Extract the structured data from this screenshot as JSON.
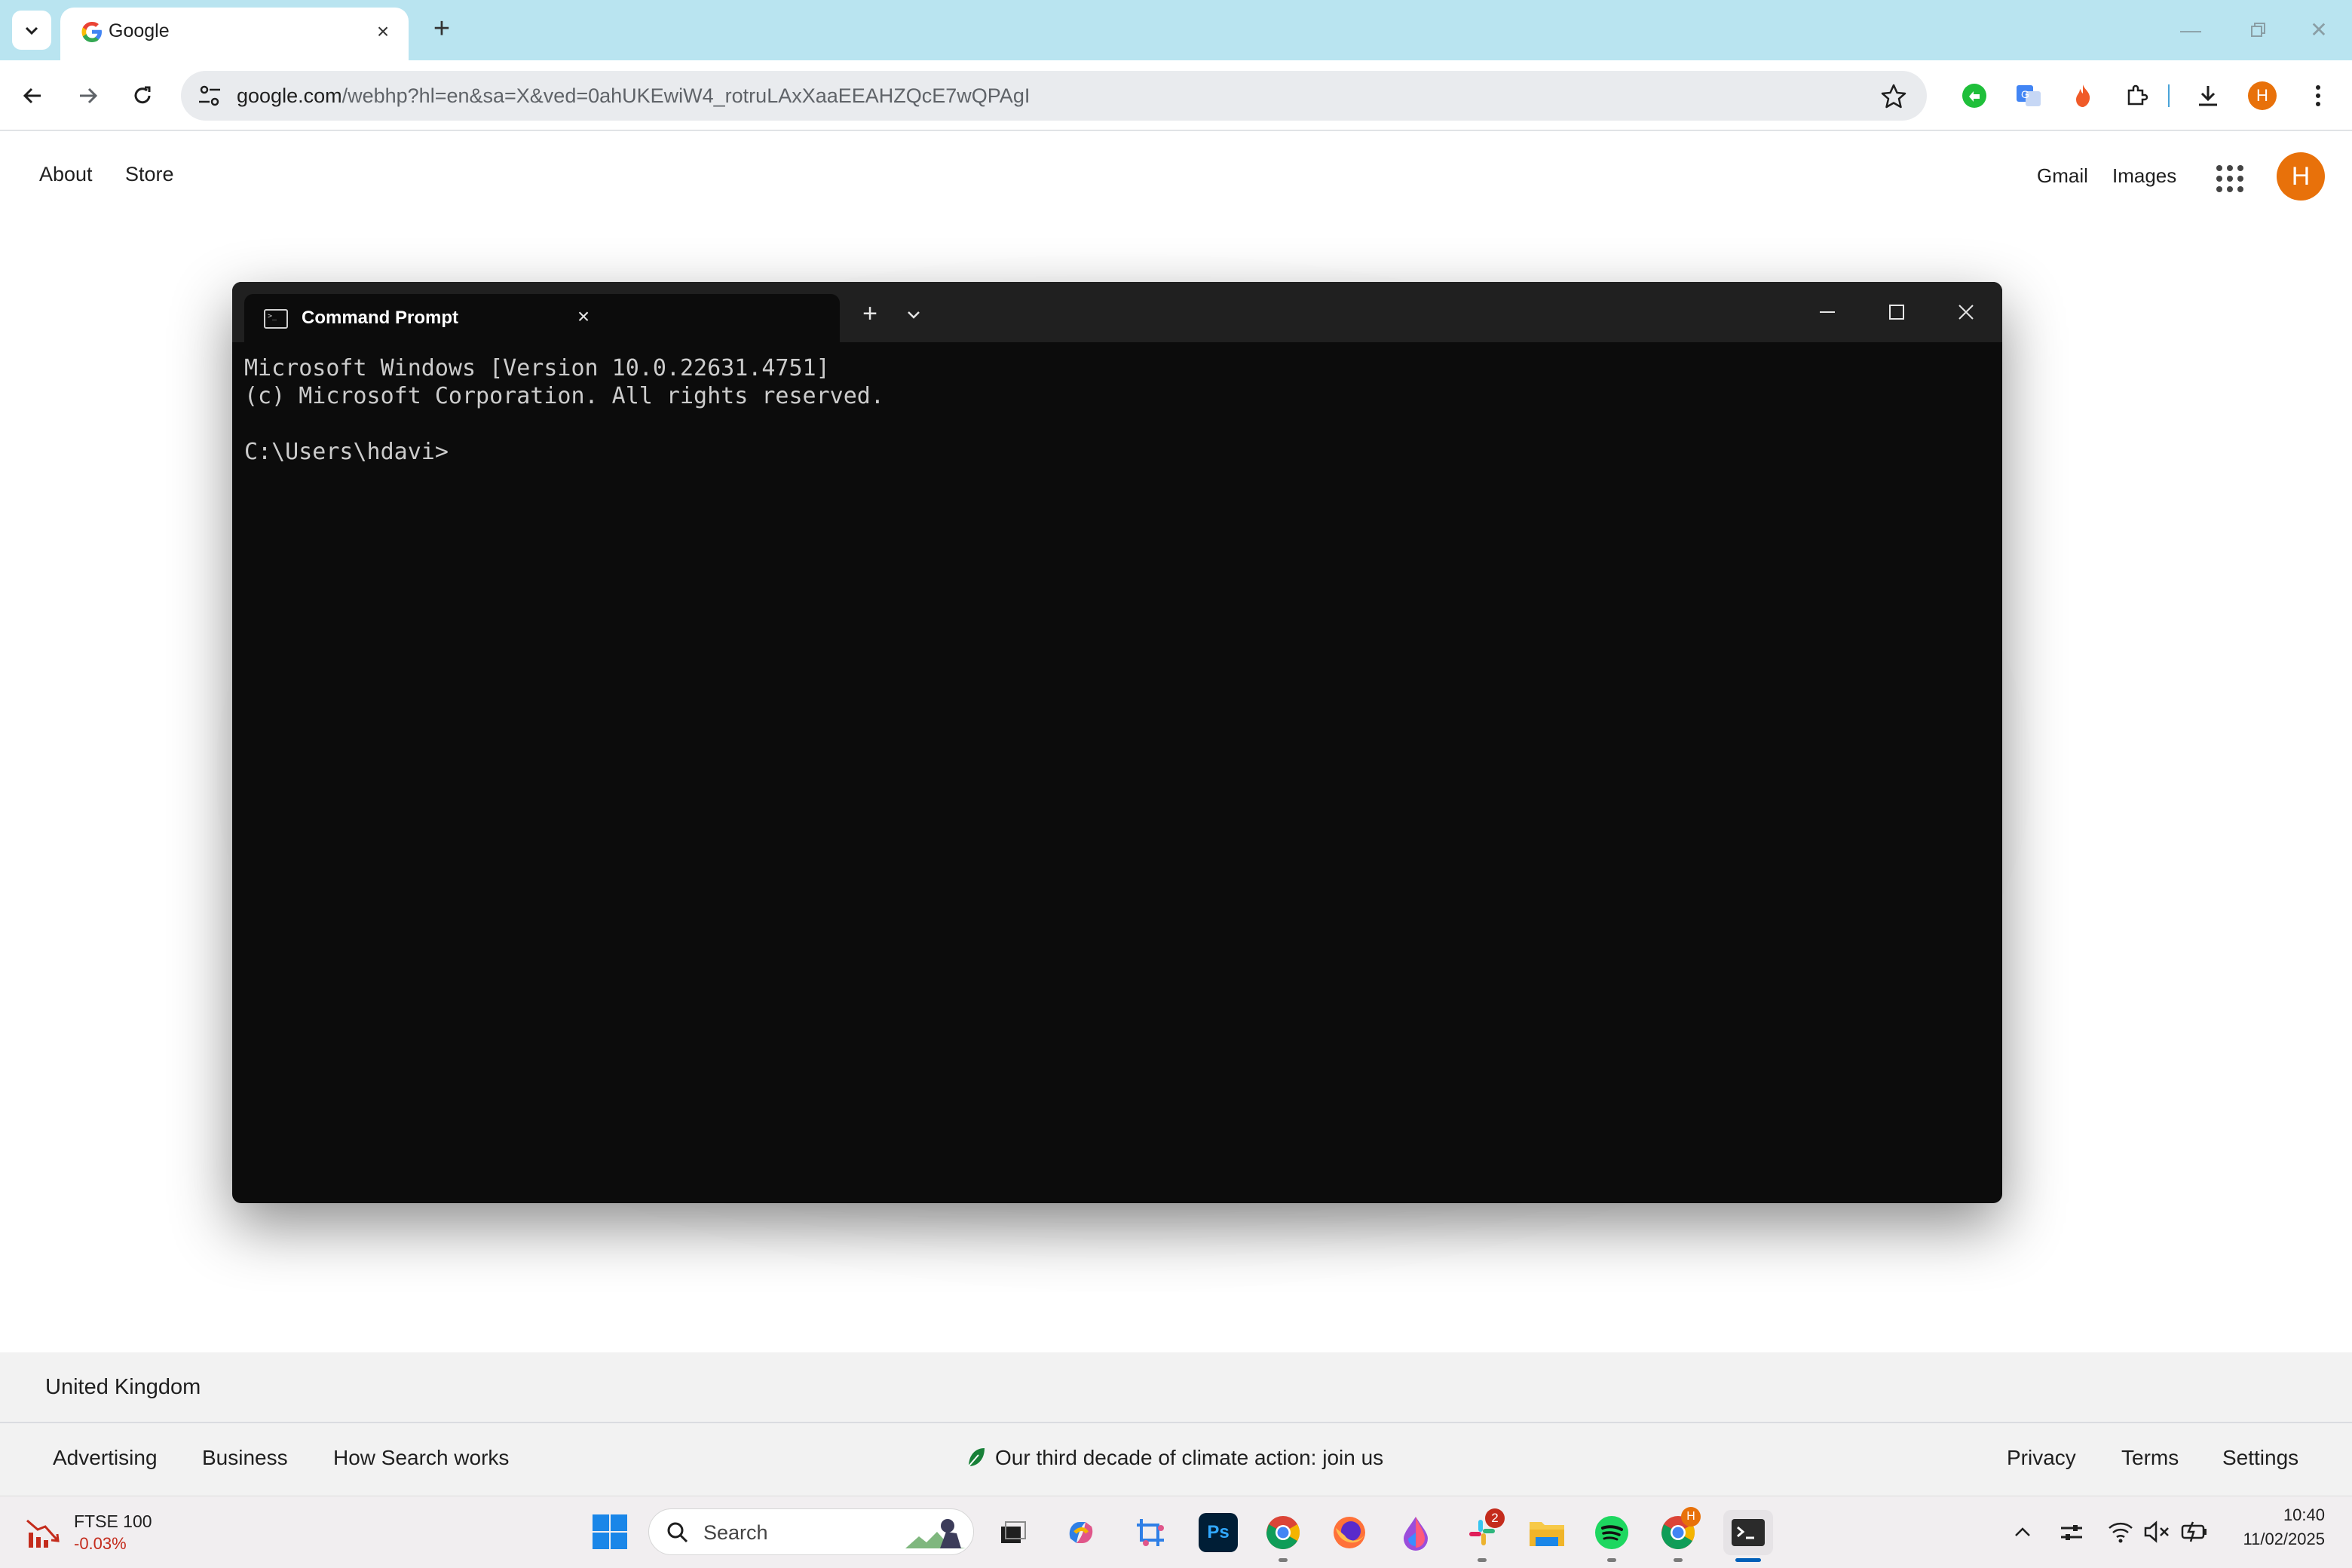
{
  "browser": {
    "tab_title": "Google",
    "url_host": "google.com",
    "url_path": "/webhp?hl=en&sa=X&ved=0ahUKEwiW4_rotruLAxXaaEEAHZQcE7wQPAgI",
    "profile_initial": "H"
  },
  "google": {
    "nav_left": [
      "About",
      "Store"
    ],
    "gmail": "Gmail",
    "images": "Images",
    "profile_initial": "H",
    "country": "United Kingdom",
    "footer_left": [
      "Advertising",
      "Business",
      "How Search works"
    ],
    "footer_center": "Our third decade of climate action: join us",
    "footer_right": [
      "Privacy",
      "Terms",
      "Settings"
    ]
  },
  "terminal": {
    "tab_title": "Command Prompt",
    "lines": [
      "Microsoft Windows [Version 10.0.22631.4751]",
      "(c) Microsoft Corporation. All rights reserved.",
      "",
      "C:\\Users\\hdavi>"
    ]
  },
  "taskbar": {
    "widget_name": "FTSE 100",
    "widget_change": "-0.03%",
    "search_label": "Search",
    "slack_badge": "2",
    "chrome_profile_badge": "H",
    "time": "10:40",
    "date": "11/02/2025"
  },
  "colors": {
    "tabstrip": "#b9e4f0",
    "avatar": "#e8710a",
    "terminal_bg": "#0c0c0c",
    "taskbar": "#f1eef0"
  }
}
